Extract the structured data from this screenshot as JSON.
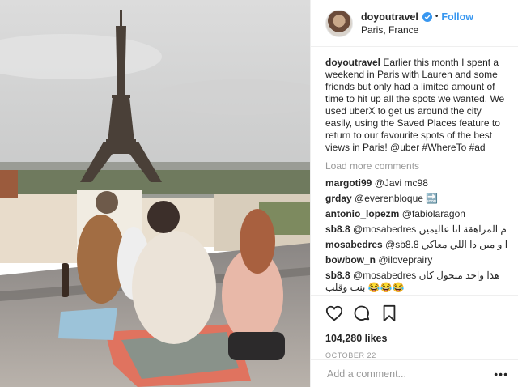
{
  "header": {
    "username": "doyoutravel",
    "separator": "•",
    "follow_label": "Follow",
    "location": "Paris, France"
  },
  "caption": {
    "username": "doyoutravel",
    "text": "Earlier this month I spent a weekend in Paris with Lauren and some friends but only had a limited amount of time to hit up all the spots we wanted. We used uberX to get us around the city easily, using the Saved Places feature to return to our favourite spots of the best views in Paris! @uber #WhereTo #ad"
  },
  "load_more": "Load more comments",
  "comments": [
    {
      "user": "margoti99",
      "text": "@Javi mc98"
    },
    {
      "user": "grday",
      "text": "@everenbloque 🔜"
    },
    {
      "user": "antonio_lopezm",
      "text": "@fabiolaragon"
    },
    {
      "user": "sb8.8",
      "text": "@mosabedres ايام المراهقة انا عاليمين"
    },
    {
      "user": "mosabedres",
      "text": "@sb8.8 اهاا و مين دا اللي معاكي ."
    },
    {
      "user": "bowbow_n",
      "text": "@iloveprairy"
    },
    {
      "user": "sb8.8",
      "text": "@mosabedres هذا واحد متحول كان بنت وقلب 😂😂😂"
    }
  ],
  "likes": "104,280 likes",
  "date": "OCTOBER 22",
  "add_comment_placeholder": "Add a comment...",
  "more_options": "•••",
  "icons": {
    "verified": "verified-badge-icon",
    "like": "heart-icon",
    "comment": "comment-bubble-icon",
    "save": "bookmark-icon",
    "more": "more-options-icon"
  },
  "colors": {
    "accent": "#3897f0",
    "muted": "#999999",
    "link": "#003569"
  }
}
